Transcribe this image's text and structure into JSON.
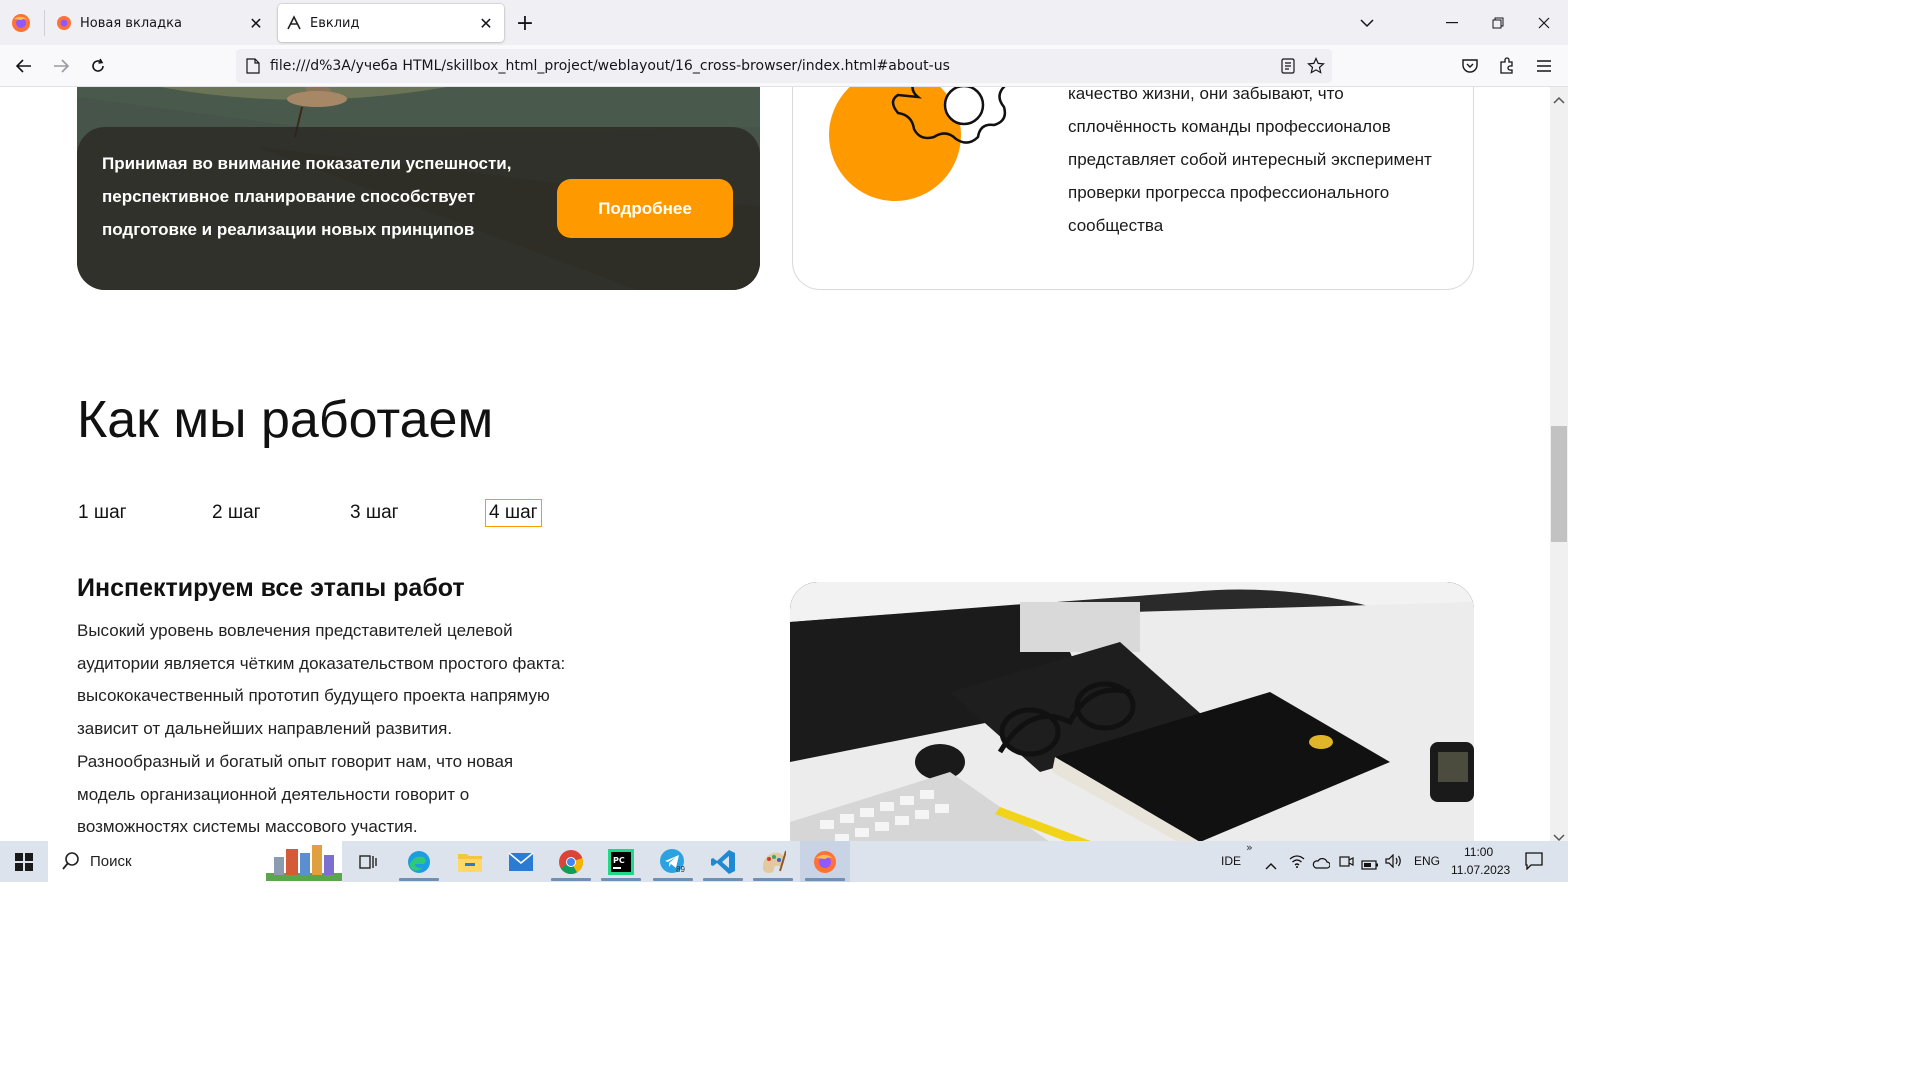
{
  "browser": {
    "tabs": [
      {
        "label": "Новая вкладка",
        "active": false
      },
      {
        "label": "Евклид",
        "active": true
      }
    ],
    "url": "file:///d%3A/учеба HTML/skillbox_html_project/weblayout/16_cross-browser/index.html#about-us"
  },
  "hero": {
    "text": "Принимая во внимание показатели успешности, перспективное планирование способствует подготовке и реализации новых принципов",
    "button_label": "Подробнее"
  },
  "info": {
    "text": "качество жизни, они забывают, что сплочённость команды профессионалов представляет собой интересный эксперимент проверки прогресса профессионального сообщества"
  },
  "how_we_work": {
    "title": "Как мы работаем",
    "steps": [
      "1 шаг",
      "2 шаг",
      "3 шаг",
      "4 шаг"
    ],
    "active_step": "4 шаг",
    "heading": "Инспектируем все этапы работ",
    "text": "Высокий уровень вовлечения представителей целевой аудитории является чётким доказательством простого факта: высококачественный прототип будущего проекта напрямую зависит от дальнейших направлений развития. Разнообразный и богатый опыт говорит нам, что новая модель организационной деятельности говорит о возможностях системы массового участия."
  },
  "taskbar": {
    "search_label": "Поиск",
    "tray": {
      "ide": "IDE",
      "lang": "ENG",
      "time": "11:00",
      "date": "11.07.2023",
      "telegram_badge": "89"
    }
  },
  "colors": {
    "accent": "#ff9900",
    "text": "#111111"
  }
}
